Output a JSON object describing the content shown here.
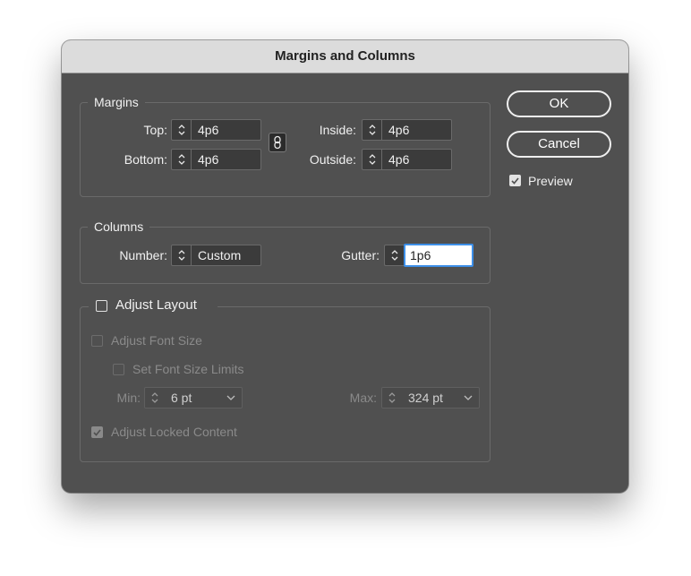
{
  "dialog": {
    "title": "Margins and Columns"
  },
  "margins": {
    "group_title": "Margins",
    "top_label": "Top:",
    "top_value": "4p6",
    "bottom_label": "Bottom:",
    "bottom_value": "4p6",
    "inside_label": "Inside:",
    "inside_value": "4p6",
    "outside_label": "Outside:",
    "outside_value": "4p6",
    "link_icon": "chain-link-icon"
  },
  "columns": {
    "group_title": "Columns",
    "number_label": "Number:",
    "number_value": "Custom",
    "gutter_label": "Gutter:",
    "gutter_value": "1p6"
  },
  "adjust_layout": {
    "label": "Adjust Layout",
    "checked": false,
    "adjust_font_size_label": "Adjust Font Size",
    "set_font_size_limits_label": "Set Font Size Limits",
    "min_label": "Min:",
    "min_value": "6 pt",
    "max_label": "Max:",
    "max_value": "324 pt",
    "adjust_locked_content_label": "Adjust Locked Content"
  },
  "buttons": {
    "ok_label": "OK",
    "cancel_label": "Cancel"
  },
  "preview": {
    "label": "Preview",
    "checked": true
  },
  "colors": {
    "dialog_bg": "#505050",
    "titlebar_bg": "#dcdcdc",
    "focus_ring": "#3d8fe8"
  }
}
